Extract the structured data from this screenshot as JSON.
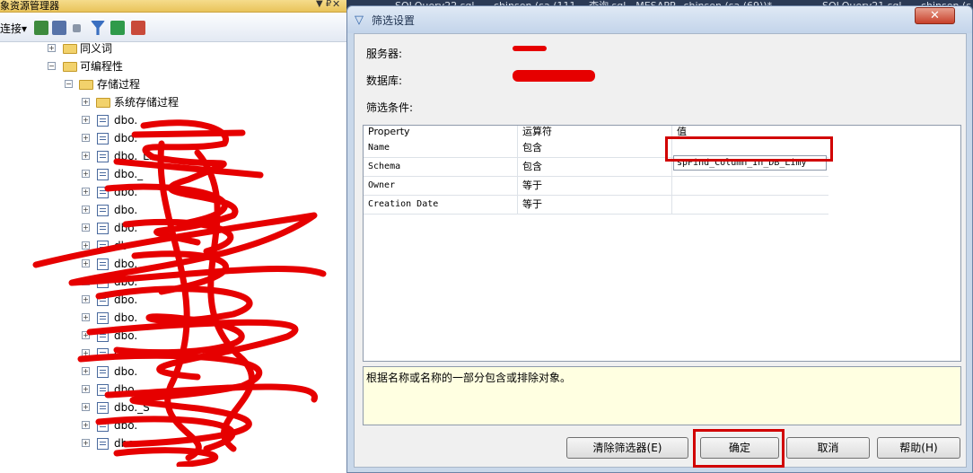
{
  "explorer": {
    "title": "象资源管理器",
    "pin_glyph": "▼ ₽",
    "close_glyph": "✕",
    "toolbar": {
      "connect_label": "连接▾"
    },
    "tree": {
      "synonyms": "同义词",
      "programmability": "可编程性",
      "stored_procedures": "存储过程",
      "system_stored_procedures": "系统存储过程",
      "procedures": [
        "dbo.",
        "dbo.",
        "dbo._Ls",
        "dbo._",
        "dbo.",
        "dbo.",
        "dbo.",
        "db",
        "dbo.",
        "dbo.",
        "dbo.",
        "dbo.",
        "dbo.",
        "dbo.S",
        "dbo.",
        "dbo.",
        "dbo._S",
        "dbo.",
        "dbo."
      ]
    }
  },
  "editor_tabs": [
    "SQLQuery22.sql - ...chinsen (sa (111))",
    "查询.sql - MESAPP...chinsen (sa (69))*",
    "SQLQuery21.sql - ...chinsen (s"
  ],
  "dialog": {
    "title": "筛选设置",
    "close_label": "✕",
    "server_label": "服务器:",
    "database_label": "数据库:",
    "filter_label": "筛选条件:",
    "grid": {
      "headers": [
        "Property",
        "运算符",
        "值"
      ],
      "rows": [
        {
          "property": "Name",
          "operator": "包含",
          "value": "spFind_Column_In_DB_Limy"
        },
        {
          "property": "Schema",
          "operator": "包含",
          "value": ""
        },
        {
          "property": "Owner",
          "operator": "等于",
          "value": ""
        },
        {
          "property": "Creation Date",
          "operator": "等于",
          "value": ""
        }
      ]
    },
    "description": "根据名称或名称的一部分包含或排除对象。",
    "buttons": {
      "clear": "清除筛选器(E)",
      "ok": "确定",
      "cancel": "取消",
      "help": "帮助(H)"
    }
  },
  "colors": {
    "annotation_red": "#d10000",
    "redaction_red": "#e60000",
    "description_bg": "#ffffe1"
  }
}
